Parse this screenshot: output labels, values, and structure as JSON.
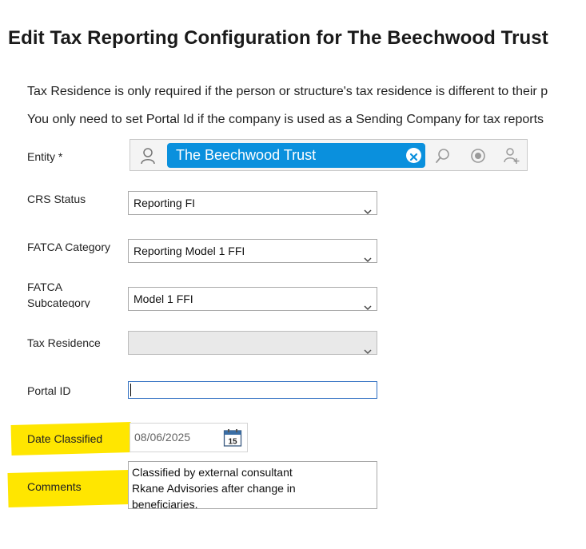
{
  "page": {
    "title": "Edit Tax Reporting Configuration for The Beechwood Trust",
    "info_line_1": "Tax Residence is only required if the person or structure's tax residence is different to their p",
    "info_line_2": "You only need to set Portal Id if the company is used as a Sending Company for tax reports"
  },
  "form": {
    "entity": {
      "label": "Entity *",
      "value": "The Beechwood Trust"
    },
    "crs_status": {
      "label": "CRS Status",
      "value": "Reporting FI"
    },
    "fatca_category": {
      "label": "FATCA Category",
      "value": "Reporting Model 1 FFI"
    },
    "fatca_subcategory": {
      "label": "FATCA Subcategory",
      "value": "Model 1 FFI"
    },
    "tax_residence": {
      "label": "Tax Residence",
      "value": ""
    },
    "portal_id": {
      "label": "Portal ID",
      "value": ""
    },
    "date_classified": {
      "label": "Date Classified",
      "value": "08/06/2025",
      "calendar_day": "15"
    },
    "comments": {
      "label": "Comments",
      "value": "Classified by external consultant\nRkane Advisories after change in\nbeneficiaries."
    }
  },
  "icons": [
    "person-icon",
    "clear-icon",
    "search-icon",
    "radio-target-icon",
    "add-person-icon",
    "chevron-down-icon",
    "calendar-icon"
  ],
  "colors": {
    "chip": "#0a90dd",
    "highlight": "#ffe600",
    "focus_border": "#2f6fc2"
  }
}
